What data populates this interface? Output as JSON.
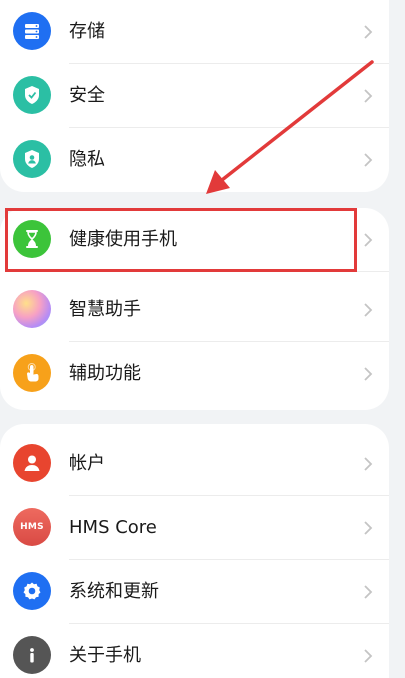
{
  "settings": {
    "groups": [
      {
        "items": [
          {
            "label": "存储",
            "icon": "storage-icon",
            "color": "#1f6ff2"
          },
          {
            "label": "安全",
            "icon": "shield-icon",
            "color": "#2bbfa4"
          },
          {
            "label": "隐私",
            "icon": "privacy-icon",
            "color": "#2bbfa4"
          }
        ]
      },
      {
        "items": [
          {
            "label": "健康使用手机",
            "icon": "hourglass-icon",
            "color": "#3cc43a"
          },
          {
            "label": "智慧助手",
            "icon": "assistant-orb-icon",
            "color": "#c08cf0"
          },
          {
            "label": "辅助功能",
            "icon": "hand-icon",
            "color": "#f7a11a"
          }
        ]
      },
      {
        "items": [
          {
            "label": "帐户",
            "icon": "user-icon",
            "color": "#e8452f"
          },
          {
            "label": "HMS Core",
            "icon": "hms-icon",
            "color": "#e2574f"
          },
          {
            "label": "系统和更新",
            "icon": "gear-icon",
            "color": "#1f6ff2"
          },
          {
            "label": "关于手机",
            "icon": "info-icon",
            "color": "#555555"
          }
        ]
      }
    ]
  },
  "annotation": {
    "highlight_color": "#e23a3a",
    "highlighted_item": "健康使用手机"
  },
  "hms_icon_text": "HMS"
}
